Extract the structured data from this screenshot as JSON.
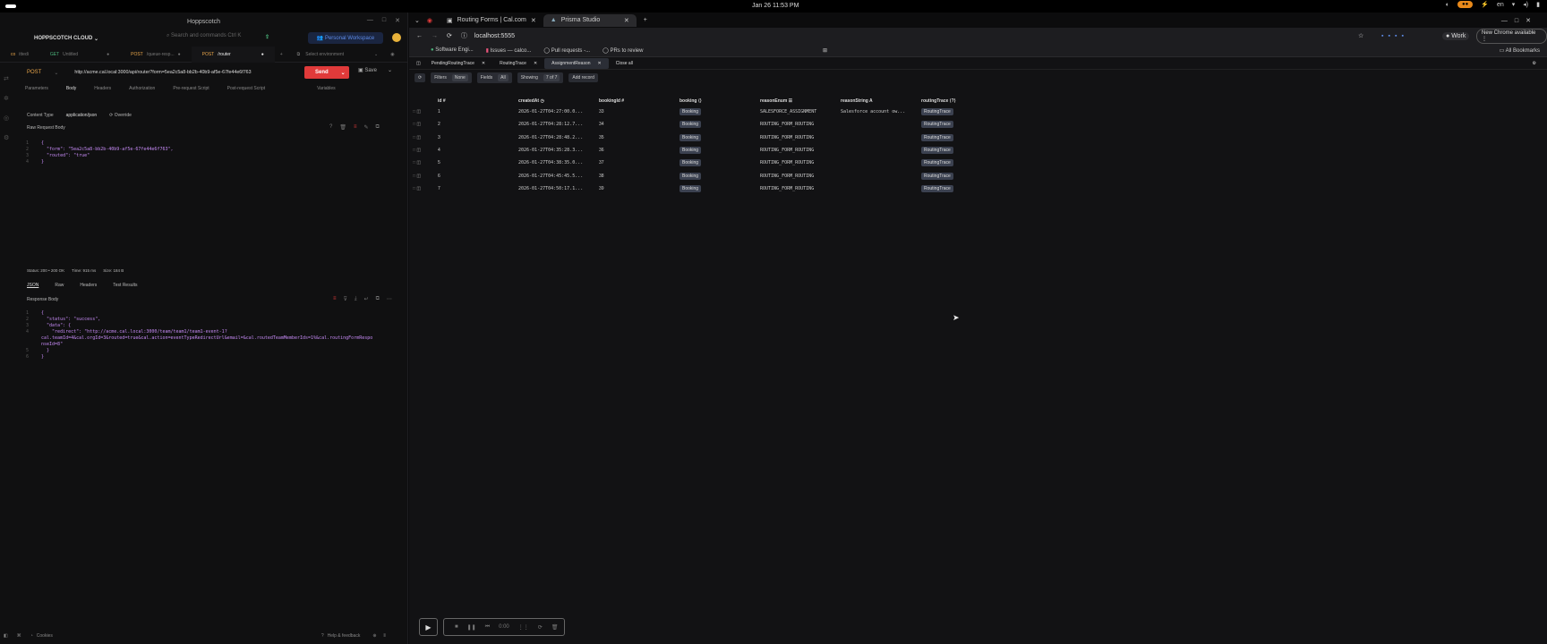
{
  "system": {
    "clock": "Jan 26  11:53 PM",
    "lang": "en",
    "badge": "⚠ ●"
  },
  "left": {
    "window_title": "Hoppscotch",
    "org": "HOPPSCOTCH CLOUD",
    "search_placeholder": "Search and commands",
    "search_kbd": "Ctrl K",
    "workspace": "Personal Workspace",
    "tabs": [
      {
        "method": "",
        "label": "ittedi"
      },
      {
        "method": "GET",
        "label": "Untitled"
      },
      {
        "method": "POST",
        "label": "/queue-resp..."
      },
      {
        "method": "POST",
        "label": "/router"
      }
    ],
    "environment": "Select environment",
    "method": "POST",
    "url": "http://acme.cal.local:3000/api/router?form=5ea2c5a8-bb2b-40b9-af5e-67fe44e6f763",
    "send": "Send",
    "save": "Save",
    "req_tabs": [
      "Parameters",
      "Body",
      "Headers",
      "Authorization",
      "Pre-request Script",
      "Post-request Script",
      "Variables"
    ],
    "content_type_label": "Content Type",
    "content_type": "application/json",
    "override": "Override",
    "raw_body_label": "Raw Request Body",
    "req_lines": [
      {
        "n": "1",
        "t": "{"
      },
      {
        "n": "2",
        "t": "  \"form\": \"5ea2c5a8-bb2b-40b9-af5e-67fe44e6f763\","
      },
      {
        "n": "3",
        "t": "  \"routed\": \"true\""
      },
      {
        "n": "4",
        "t": "}"
      }
    ],
    "status": "Status: 200 • 200 OK",
    "time": "Time: 915 ms",
    "size": "Size: 184 B",
    "resp_tabs": [
      "JSON",
      "Raw",
      "Headers",
      "Test Results"
    ],
    "resp_body_label": "Response Body",
    "resp_lines": [
      {
        "n": "1",
        "t": "{"
      },
      {
        "n": "2",
        "t": "  \"status\": \"success\","
      },
      {
        "n": "3",
        "t": "  \"data\": {"
      },
      {
        "n": "4",
        "t": "    \"redirect\": \"http://acme.cal.local:3000/team/team1/team1-event-1?"
      },
      {
        "n": "",
        "t": "cal.teamId=4&cal.orgId=3&routed=true&cal.action=eventTypeRedirectUrl&email=&cal.routedTeamMemberIds=1%&cal.routingFormRespo"
      },
      {
        "n": "",
        "t": "nseId=8\""
      },
      {
        "n": "5",
        "t": "  }"
      },
      {
        "n": "6",
        "t": "}"
      }
    ],
    "cookies": "Cookies",
    "help": "Help & feedback"
  },
  "browser": {
    "tabs": [
      "Routing Forms | Cal.com",
      "Prisma Studio"
    ],
    "url": "localhost:5555",
    "profile": "Work",
    "update": "New Chrome available",
    "bookmarks": [
      "Software Engi...",
      "Issues — calco...",
      "Pull requests -...",
      "PRs to review"
    ],
    "all_bookmarks": "All Bookmarks"
  },
  "prisma": {
    "tabs": [
      "PendingRoutingTrace",
      "RoutingTrace",
      "AssignmentReason",
      "Close all"
    ],
    "filters": "Filters",
    "filters_val": "None",
    "fields": "Fields",
    "fields_val": "All",
    "showing": "Showing",
    "showing_val": "7 of 7",
    "add": "Add record",
    "columns": [
      "id #",
      "createdAt ◷",
      "bookingId #",
      "booking ⟨⟩",
      "reasonEnum ☰",
      "reasonString A",
      "routingTrace ⟨?⟩"
    ],
    "rows": [
      {
        "id": "1",
        "createdAt": "2026-01-27T04:27:00.0...",
        "bookingId": "33",
        "booking": "Booking",
        "reasonEnum": "SALESFORCE_ASSIGNMENT",
        "reasonString": "Salesforce account ow...",
        "routingTrace": "RoutingTrace"
      },
      {
        "id": "2",
        "createdAt": "2026-01-27T04:28:12.7...",
        "bookingId": "34",
        "booking": "Booking",
        "reasonEnum": "ROUTING_FORM_ROUTING",
        "reasonString": "",
        "routingTrace": "RoutingTrace"
      },
      {
        "id": "3",
        "createdAt": "2026-01-27T04:28:48.2...",
        "bookingId": "35",
        "booking": "Booking",
        "reasonEnum": "ROUTING_FORM_ROUTING",
        "reasonString": "",
        "routingTrace": "RoutingTrace"
      },
      {
        "id": "4",
        "createdAt": "2026-01-27T04:35:28.3...",
        "bookingId": "36",
        "booking": "Booking",
        "reasonEnum": "ROUTING_FORM_ROUTING",
        "reasonString": "",
        "routingTrace": "RoutingTrace"
      },
      {
        "id": "5",
        "createdAt": "2026-01-27T04:38:35.0...",
        "bookingId": "37",
        "booking": "Booking",
        "reasonEnum": "ROUTING_FORM_ROUTING",
        "reasonString": "",
        "routingTrace": "RoutingTrace"
      },
      {
        "id": "6",
        "createdAt": "2026-01-27T04:45:45.5...",
        "bookingId": "38",
        "booking": "Booking",
        "reasonEnum": "ROUTING_FORM_ROUTING",
        "reasonString": "",
        "routingTrace": "RoutingTrace"
      },
      {
        "id": "7",
        "createdAt": "2026-01-27T04:50:17.1...",
        "bookingId": "39",
        "booking": "Booking",
        "reasonEnum": "ROUTING_FORM_ROUTING",
        "reasonString": "",
        "routingTrace": "RoutingTrace"
      }
    ]
  },
  "recorder": {
    "time": "0:00"
  },
  "icons": {
    "colors": {
      "send": "#e03a3a",
      "workspace": "#5d8be8",
      "accent_orange": "#e8891a"
    }
  }
}
